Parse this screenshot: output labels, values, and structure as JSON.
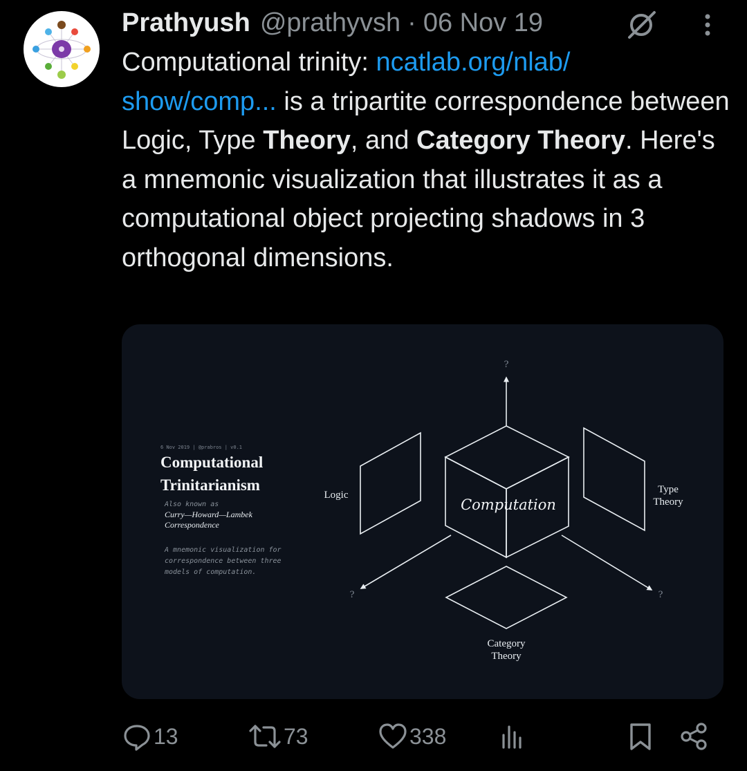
{
  "author": {
    "name": "Prathyush",
    "handle": "@prathyvsh",
    "separator": "·",
    "date": "06 Nov 19"
  },
  "tweet": {
    "p1": "Computational trinity: ",
    "link": "ncatlab.org/nlab/ show/comp...",
    "p2": " is a tripartite correspondence between Logic, Type ",
    "b1": "Theory",
    "p3": ", and ",
    "b2": "Category Theory",
    "p4": ". Here's a mnemonic visualization that illustrates it as a computational object projecting shadows in 3 orthogonal dimensions."
  },
  "media": {
    "meta": "6 Nov 2019 | @prabros | v0.1",
    "title_line1": "Computational",
    "title_line2": "Trinitarianism",
    "aka": "Also known as",
    "alias_line1": "Curry—Howard—Lambek",
    "alias_line2": "Correspondence",
    "desc_line1": "A mnemonic visualization for",
    "desc_line2": "correspondence between three",
    "desc_line3": "models of computation.",
    "center_label": "Computation",
    "left_label": "Logic",
    "right_label_line1": "Type",
    "right_label_line2": "Theory",
    "bottom_label_line1": "Category",
    "bottom_label_line2": "Theory",
    "q_top": "?",
    "q_left": "?",
    "q_right": "?"
  },
  "actions": {
    "replies": "13",
    "reposts": "73",
    "likes": "338"
  },
  "icons": {
    "reply": "reply-icon",
    "repost": "repost-icon",
    "like": "heart-icon",
    "views": "analytics-icon",
    "bookmark": "bookmark-icon",
    "share": "share-icon",
    "grok": "grok-icon",
    "more": "more-icon"
  },
  "colors": {
    "background": "#000000",
    "text": "#e7e9ea",
    "muted": "#8b9196",
    "link": "#1d9bf0",
    "media_bg": "#0d121b"
  }
}
